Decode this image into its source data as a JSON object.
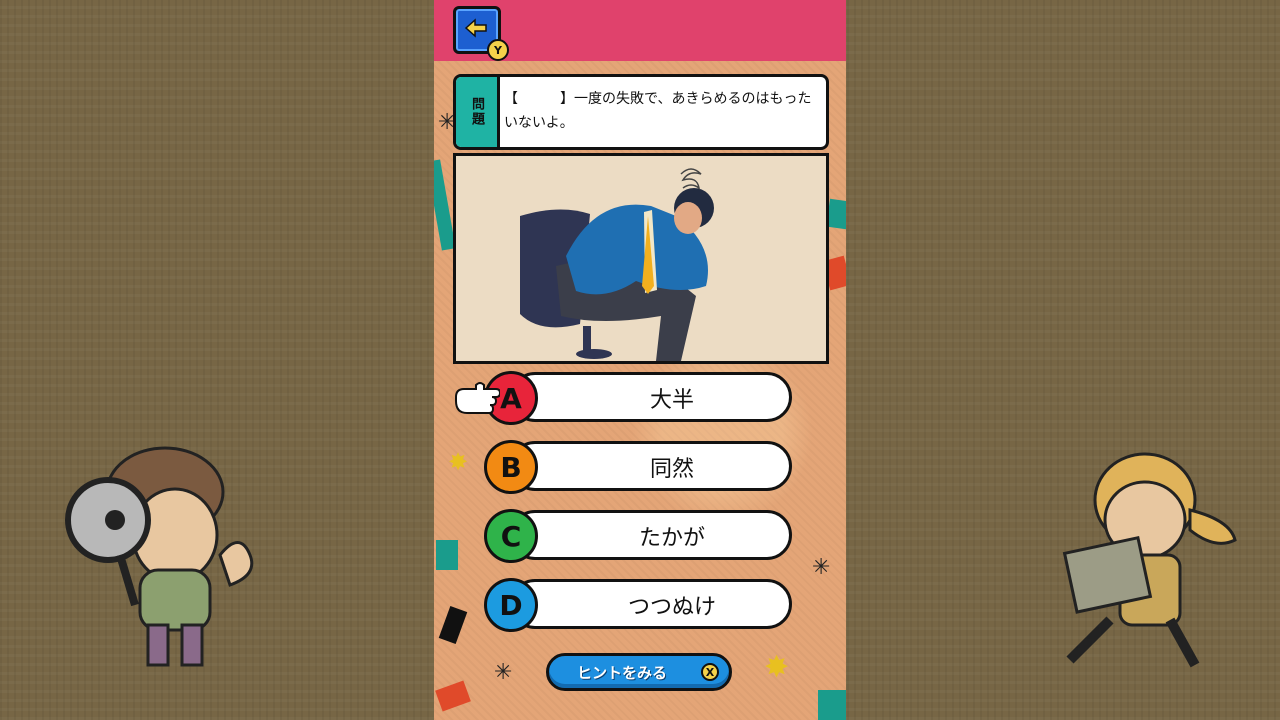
{
  "header": {
    "back_badge": "Y"
  },
  "question": {
    "tag": "問題",
    "text": "【　　　】一度の失敗で、あきらめるのはもったいないよ。"
  },
  "choices": [
    {
      "letter": "A",
      "text": "大半",
      "color": "#e8243a"
    },
    {
      "letter": "B",
      "text": "同然",
      "color": "#f28a13"
    },
    {
      "letter": "C",
      "text": "たかが",
      "color": "#2fb34a"
    },
    {
      "letter": "D",
      "text": "つつぬけ",
      "color": "#1c9be0"
    }
  ],
  "hint": {
    "label": "ヒントをみる",
    "badge": "X"
  },
  "colors": {
    "topbar": "#e0426c",
    "panel": "#e4a577",
    "tag": "#1fb3a4"
  }
}
